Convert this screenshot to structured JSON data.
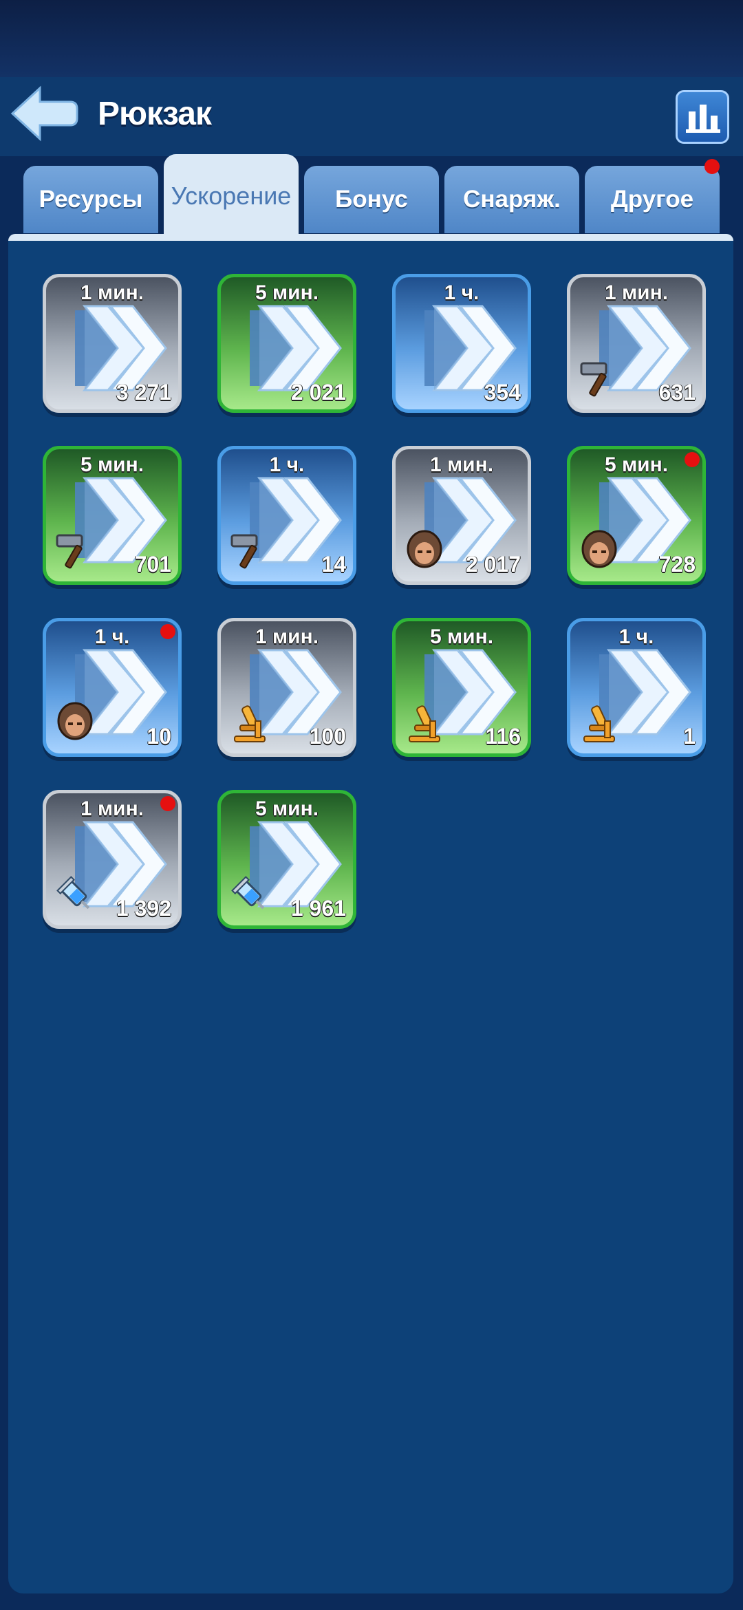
{
  "header": {
    "title": "Рюкзак"
  },
  "tabs": [
    {
      "label": "Ресурсы",
      "active": false,
      "has_notification": false
    },
    {
      "label": "Ускорение",
      "active": true,
      "has_notification": false
    },
    {
      "label": "Бонус",
      "active": false,
      "has_notification": false
    },
    {
      "label": "Снаряж.",
      "active": false,
      "has_notification": false
    },
    {
      "label": "Другое",
      "active": false,
      "has_notification": true
    }
  ],
  "items": [
    {
      "duration": "1 мин.",
      "count": "3 271",
      "rarity": "grey",
      "type_icon": "none",
      "new": false
    },
    {
      "duration": "5 мин.",
      "count": "2 021",
      "rarity": "green",
      "type_icon": "none",
      "new": false
    },
    {
      "duration": "1 ч.",
      "count": "354",
      "rarity": "blue",
      "type_icon": "none",
      "new": false
    },
    {
      "duration": "1 мин.",
      "count": "631",
      "rarity": "grey",
      "type_icon": "hammer",
      "new": false
    },
    {
      "duration": "5 мин.",
      "count": "701",
      "rarity": "green",
      "type_icon": "hammer",
      "new": false
    },
    {
      "duration": "1 ч.",
      "count": "14",
      "rarity": "blue",
      "type_icon": "hammer",
      "new": false
    },
    {
      "duration": "1 мин.",
      "count": "2 017",
      "rarity": "grey",
      "type_icon": "soldier",
      "new": false
    },
    {
      "duration": "5 мин.",
      "count": "728",
      "rarity": "green",
      "type_icon": "soldier",
      "new": true
    },
    {
      "duration": "1 ч.",
      "count": "10",
      "rarity": "blue",
      "type_icon": "soldier",
      "new": true
    },
    {
      "duration": "1 мин.",
      "count": "100",
      "rarity": "grey",
      "type_icon": "microscope",
      "new": false
    },
    {
      "duration": "5 мин.",
      "count": "116",
      "rarity": "green",
      "type_icon": "microscope",
      "new": false
    },
    {
      "duration": "1 ч.",
      "count": "1",
      "rarity": "blue",
      "type_icon": "microscope",
      "new": false
    },
    {
      "duration": "1 мин.",
      "count": "1 392",
      "rarity": "grey",
      "type_icon": "syringe",
      "new": true
    },
    {
      "duration": "5 мин.",
      "count": "1 961",
      "rarity": "green",
      "type_icon": "syringe",
      "new": false
    }
  ],
  "colors": {
    "background": "#0b2a5a",
    "panel": "#0d4178",
    "notification": "#e51010"
  }
}
